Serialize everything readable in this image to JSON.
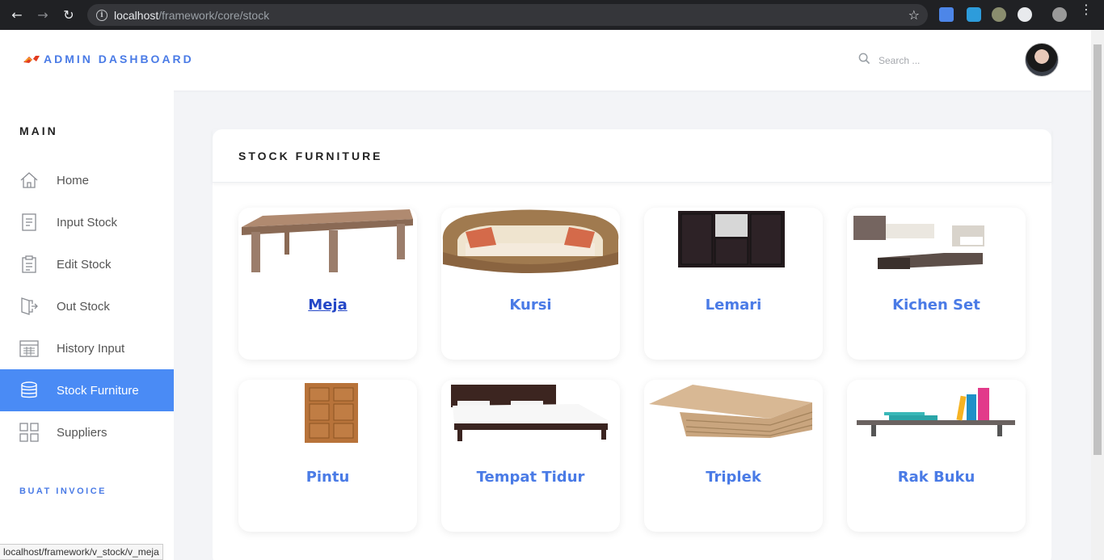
{
  "browser": {
    "url_host": "localhost",
    "url_path": "/framework/core/stock"
  },
  "header": {
    "brand": "ADMIN DASHBOARD",
    "search_placeholder": "Search ..."
  },
  "sidebar": {
    "section": "MAIN",
    "items": [
      {
        "label": "Home",
        "icon": "home-icon"
      },
      {
        "label": "Input Stock",
        "icon": "document-icon"
      },
      {
        "label": "Edit Stock",
        "icon": "clipboard-icon"
      },
      {
        "label": "Out Stock",
        "icon": "exit-icon"
      },
      {
        "label": "History Input",
        "icon": "calendar-icon"
      },
      {
        "label": "Stock Furniture",
        "icon": "database-icon",
        "active": true
      },
      {
        "label": "Suppliers",
        "icon": "grid-icon"
      }
    ],
    "secondary": "BUAT INVOICE"
  },
  "main": {
    "title": "STOCK FURNITURE",
    "items": [
      {
        "label": "Meja"
      },
      {
        "label": "Kursi"
      },
      {
        "label": "Lemari"
      },
      {
        "label": "Kichen Set"
      },
      {
        "label": "Pintu"
      },
      {
        "label": "Tempat Tidur"
      },
      {
        "label": "Triplek"
      },
      {
        "label": "Rak Buku"
      }
    ]
  },
  "status_bar": {
    "text": "localhost/framework/v_stock/v_meja"
  },
  "colors": {
    "accent": "#4a7be6",
    "active_bg": "#4a8bf5"
  }
}
